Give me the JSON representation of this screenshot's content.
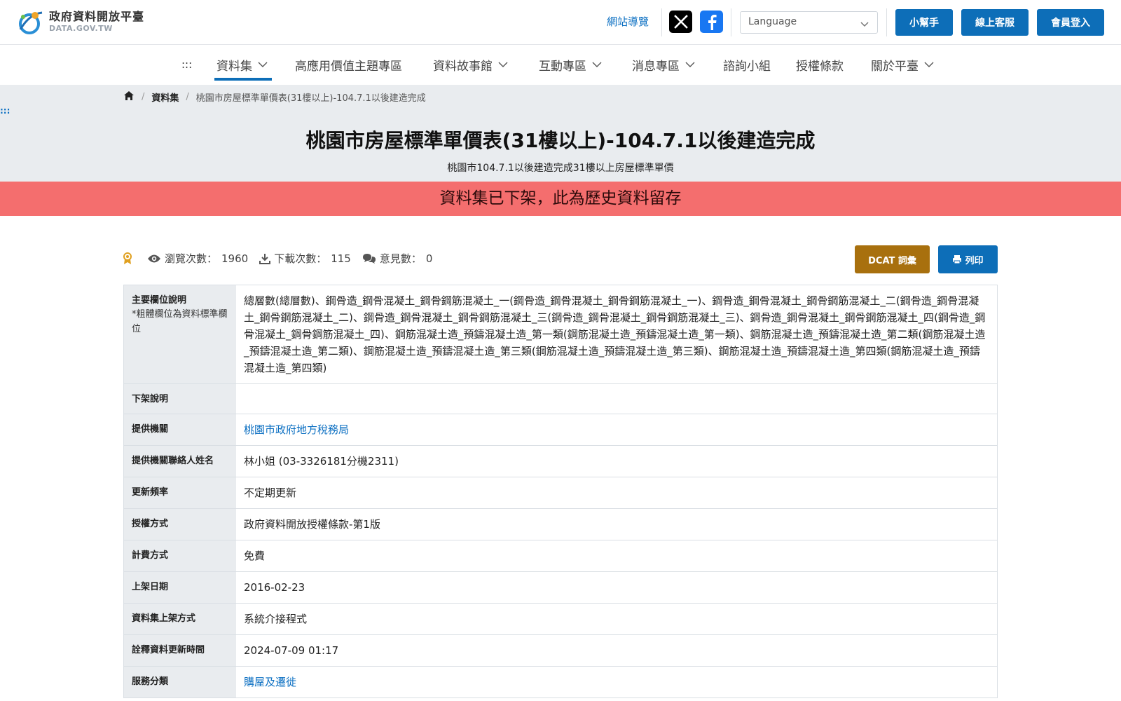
{
  "header": {
    "logo_cn": "政府資料開放平臺",
    "logo_en": "DATA.GOV.TW",
    "sitemap": "網站導覽",
    "language_placeholder": "Language",
    "helper_btn": "小幫手",
    "support_btn": "線上客服",
    "login_btn": "會員登入"
  },
  "nav": {
    "accesskey": ":::",
    "items": [
      {
        "label": "資料集",
        "dropdown": true
      },
      {
        "label": "高應用價值主題專區",
        "dropdown": false
      },
      {
        "label": "資料故事館",
        "dropdown": true
      },
      {
        "label": "互動專區",
        "dropdown": true
      },
      {
        "label": "消息專區",
        "dropdown": true
      },
      {
        "label": "諮詢小組",
        "dropdown": false
      },
      {
        "label": "授權條款",
        "dropdown": false
      },
      {
        "label": "關於平臺",
        "dropdown": true
      }
    ]
  },
  "breadcrumb": {
    "datasets": "資料集",
    "current": "桃園市房屋標準單價表(31樓以上)-104.7.1以後建造完成"
  },
  "page": {
    "accesskey": ":::",
    "title": "桃園市房屋標準單價表(31樓以上)-104.7.1以後建造完成",
    "subtitle": "桃園市104.7.1以後建造完成31樓以上房屋標準單價",
    "alert": "資料集已下架，此為歷史資料留存"
  },
  "stats": {
    "views_label": "瀏覽次數：",
    "views": "1960",
    "downloads_label": "下載次數：",
    "downloads": "115",
    "comments_label": "意見數：",
    "comments": "0"
  },
  "actions": {
    "dcat": "DCAT 詞彙",
    "print": "列印"
  },
  "details": {
    "main_fields_label": "主要欄位說明",
    "main_fields_note": "*粗體欄位為資料標準欄位",
    "main_fields_value": "總層數(總層數)、鋼骨造_鋼骨混凝土_鋼骨鋼筋混凝土_一(鋼骨造_鋼骨混凝土_鋼骨鋼筋混凝土_一)、鋼骨造_鋼骨混凝土_鋼骨鋼筋混凝土_二(鋼骨造_鋼骨混凝土_鋼骨鋼筋混凝土_二)、鋼骨造_鋼骨混凝土_鋼骨鋼筋混凝土_三(鋼骨造_鋼骨混凝土_鋼骨鋼筋混凝土_三)、鋼骨造_鋼骨混凝土_鋼骨鋼筋混凝土_四(鋼骨造_鋼骨混凝土_鋼骨鋼筋混凝土_四)、鋼筋混凝土造_預鑄混凝土造_第一類(鋼筋混凝土造_預鑄混凝土造_第一類)、鋼筋混凝土造_預鑄混凝土造_第二類(鋼筋混凝土造_預鑄混凝土造_第二類)、鋼筋混凝土造_預鑄混凝土造_第三類(鋼筋混凝土造_預鑄混凝土造_第三類)、鋼筋混凝土造_預鑄混凝土造_第四類(鋼筋混凝土造_預鑄混凝土造_第四類)",
    "delist_label": "下架說明",
    "delist_value": "",
    "provider_label": "提供機關",
    "provider_value": "桃園市政府地方稅務局",
    "contact_label": "提供機關聯絡人姓名",
    "contact_value": "林小姐 (03-3326181分機2311)",
    "frequency_label": "更新頻率",
    "frequency_value": "不定期更新",
    "license_label": "授權方式",
    "license_value": "政府資料開放授權條款-第1版",
    "fee_label": "計費方式",
    "fee_value": "免費",
    "published_label": "上架日期",
    "published_value": "2016-02-23",
    "method_label": "資料集上架方式",
    "method_value": "系統介接程式",
    "meta_updated_label": "詮釋資料更新時間",
    "meta_updated_value": "2024-07-09 01:17",
    "service_label": "服務分類",
    "service_value": "購屋及遷徙"
  },
  "colors": {
    "primary": "#0d6eb8",
    "dcat": "#a8700e",
    "alert": "#f46e6e",
    "hero_bg": "#e9ecef",
    "link": "#0b6fc2"
  }
}
